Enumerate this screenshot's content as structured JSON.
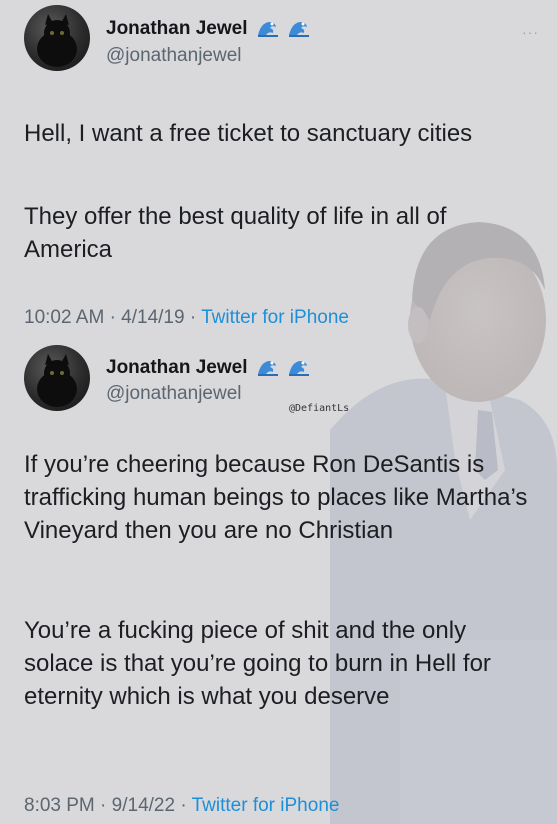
{
  "tweets": [
    {
      "display_name": "Jonathan Jewel",
      "handle": "@jonathanjewel",
      "paragraphs": [
        "Hell, I want a free ticket to sanctuary cities",
        "They offer the best quality of life in all of America"
      ],
      "time": "10:02 AM",
      "date": "4/14/19",
      "separator": "·",
      "source": "Twitter for iPhone"
    },
    {
      "display_name": "Jonathan Jewel",
      "handle": "@jonathanjewel",
      "paragraphs": [
        "If you’re cheering because Ron DeSantis is trafficking human beings to places like Martha’s Vineyard then you are no Christian",
        "You’re a fucking piece of shit and the only solace is that you’re going to burn in Hell for eternity which is what you deserve"
      ],
      "time": "8:03 PM",
      "date": "9/14/22",
      "separator": "·",
      "source": "Twitter for iPhone"
    }
  ],
  "watermark": "@DefiantLs",
  "more_menu": "···",
  "colors": {
    "link": "#1d8fd8",
    "secondary_text": "#5c6670",
    "background": "#d9d9dc"
  },
  "icons": [
    "wave-emoji-icon",
    "more-options-icon",
    "avatar-black-cat"
  ]
}
